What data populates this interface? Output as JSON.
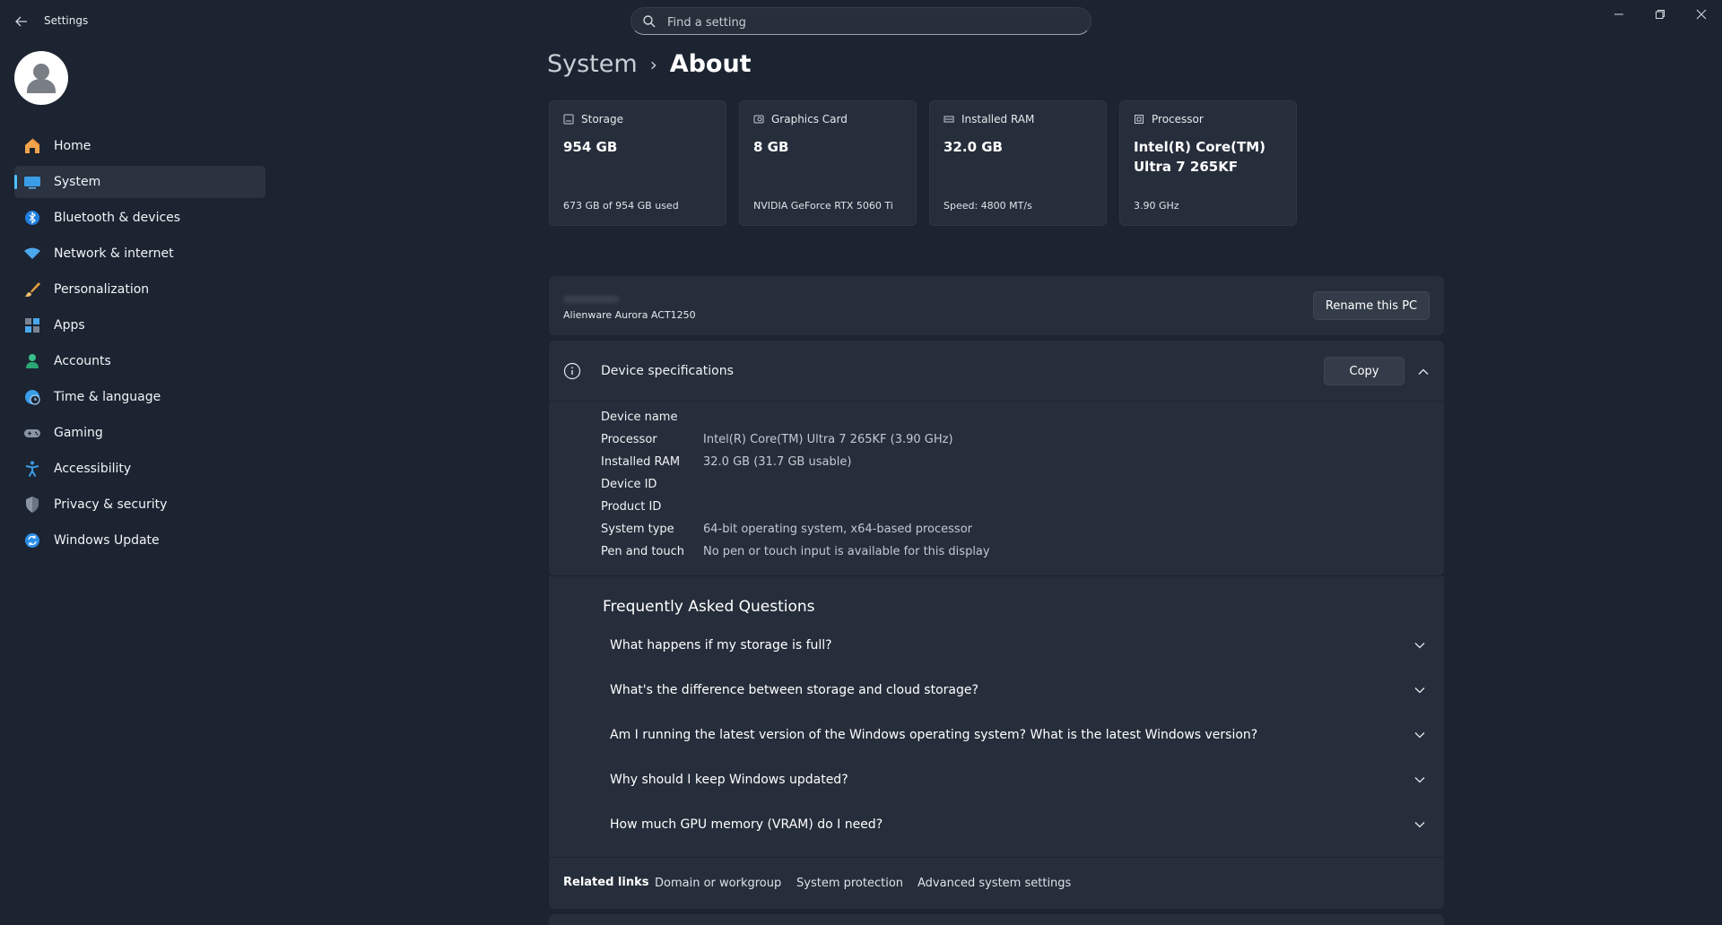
{
  "window": {
    "title": "Settings",
    "search_placeholder": "Find a setting"
  },
  "sidebar": {
    "items": [
      {
        "label": "Home",
        "icon": "home-icon"
      },
      {
        "label": "System",
        "icon": "system-icon",
        "active": true
      },
      {
        "label": "Bluetooth & devices",
        "icon": "bluetooth-icon"
      },
      {
        "label": "Network & internet",
        "icon": "wifi-icon"
      },
      {
        "label": "Personalization",
        "icon": "brush-icon"
      },
      {
        "label": "Apps",
        "icon": "apps-icon"
      },
      {
        "label": "Accounts",
        "icon": "person-icon"
      },
      {
        "label": "Time & language",
        "icon": "globe-clock-icon"
      },
      {
        "label": "Gaming",
        "icon": "gamepad-icon"
      },
      {
        "label": "Accessibility",
        "icon": "accessibility-icon"
      },
      {
        "label": "Privacy & security",
        "icon": "shield-icon"
      },
      {
        "label": "Windows Update",
        "icon": "update-icon"
      }
    ]
  },
  "breadcrumb": {
    "parent": "System",
    "separator": "›",
    "current": "About"
  },
  "cards": [
    {
      "label": "Storage",
      "value": "954 GB",
      "sub": "673 GB of 954 GB used",
      "icon": "storage-icon"
    },
    {
      "label": "Graphics Card",
      "value": "8 GB",
      "sub": "NVIDIA GeForce RTX 5060 Ti",
      "icon": "gpu-icon"
    },
    {
      "label": "Installed RAM",
      "value": "32.0 GB",
      "sub": "Speed: 4800 MT/s",
      "icon": "ram-icon"
    },
    {
      "label": "Processor",
      "value": "Intel(R) Core(TM) Ultra 7 265KF",
      "sub": "3.90 GHz",
      "icon": "cpu-icon"
    }
  ],
  "pc": {
    "model": "Alienware Aurora ACT1250",
    "rename_label": "Rename this PC"
  },
  "specs": {
    "title": "Device specifications",
    "copy_label": "Copy",
    "rows": [
      {
        "key": "Device name",
        "value": ""
      },
      {
        "key": "Processor",
        "value": "Intel(R) Core(TM) Ultra 7 265KF (3.90 GHz)"
      },
      {
        "key": "Installed RAM",
        "value": "32.0 GB (31.7 GB usable)"
      },
      {
        "key": "Device ID",
        "value": ""
      },
      {
        "key": "Product ID",
        "value": ""
      },
      {
        "key": "System type",
        "value": "64-bit operating system, x64-based processor"
      },
      {
        "key": "Pen and touch",
        "value": "No pen or touch input is available for this display"
      }
    ]
  },
  "faq": {
    "title": "Frequently Asked Questions",
    "items": [
      "What happens if my storage is full?",
      "What's the difference between storage and cloud storage?",
      "Am I running the latest version of the Windows operating system? What is the latest Windows version?",
      "Why should I keep Windows updated?",
      "How much GPU memory (VRAM) do I need?"
    ]
  },
  "related": {
    "label": "Related links",
    "links": [
      "Domain or workgroup",
      "System protection",
      "Advanced system settings"
    ]
  },
  "colors": {
    "background": "#1c2431",
    "card": "#262e3b",
    "accent": "#4cc2ff"
  }
}
